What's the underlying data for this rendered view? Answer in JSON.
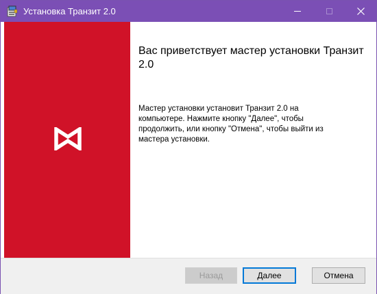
{
  "window": {
    "title": "Установка Транзит 2.0",
    "icon": "installer-icon",
    "controls": [
      "minimize-icon",
      "maximize-icon",
      "close-icon"
    ]
  },
  "banner": {
    "logo": "brand-logo-icon",
    "color": "#d01228"
  },
  "content": {
    "heading": "Вас приветствует мастер установки Транзит 2.0",
    "body": "Мастер установки установит Транзит 2.0 на компьютере. Нажмите кнопку \"Далее\", чтобы продолжить, или кнопку \"Отмена\", чтобы выйти из мастера установки."
  },
  "buttons": {
    "back": "Назад",
    "next": "Далее",
    "cancel": "Отмена"
  },
  "colors": {
    "titlebar": "#7b4fb5",
    "accent_focus": "#0078d7"
  }
}
